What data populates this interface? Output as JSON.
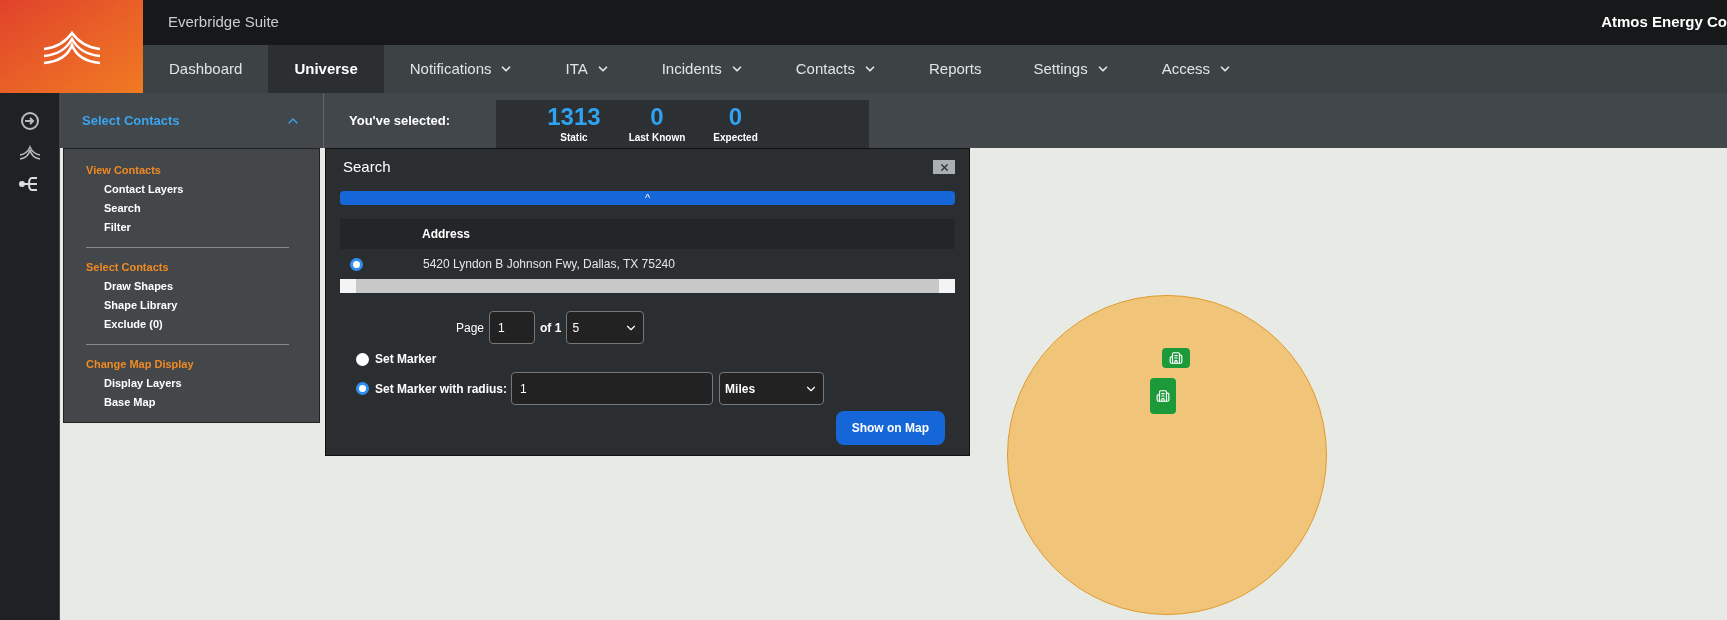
{
  "header": {
    "suite_title": "Everbridge Suite",
    "org_name": "Atmos Energy Co"
  },
  "nav": [
    {
      "label": "Dashboard",
      "selected": false,
      "has_menu": false
    },
    {
      "label": "Universe",
      "selected": true,
      "has_menu": false
    },
    {
      "label": "Notifications",
      "selected": false,
      "has_menu": true
    },
    {
      "label": "ITA",
      "selected": false,
      "has_menu": true
    },
    {
      "label": "Incidents",
      "selected": false,
      "has_menu": true
    },
    {
      "label": "Contacts",
      "selected": false,
      "has_menu": true
    },
    {
      "label": "Reports",
      "selected": false,
      "has_menu": false
    },
    {
      "label": "Settings",
      "selected": false,
      "has_menu": true
    },
    {
      "label": "Access",
      "selected": false,
      "has_menu": true
    }
  ],
  "select_contacts": {
    "label": "Select Contacts",
    "expanded": true
  },
  "selection_summary": {
    "label": "You've selected:",
    "counters": [
      {
        "value": "1313",
        "caption": "Static"
      },
      {
        "value": "0",
        "caption": "Last Known"
      },
      {
        "value": "0",
        "caption": "Expected"
      }
    ]
  },
  "menu": [
    {
      "heading": "View Contacts",
      "items": [
        "Contact Layers",
        "Search",
        "Filter"
      ]
    },
    {
      "heading": "Select Contacts",
      "items": [
        "Draw Shapes",
        "Shape Library",
        "Exclude (0)"
      ]
    },
    {
      "heading": "Change Map Display",
      "items": [
        "Display Layers",
        "Base Map"
      ]
    }
  ],
  "search_dialog": {
    "title": "Search",
    "collapse_glyph": "^",
    "column": "Address",
    "results": [
      {
        "address": "5420 Lyndon B Johnson Fwy, Dallas, TX 75240",
        "selected": true
      }
    ],
    "page_label": "Page",
    "page_value": "1",
    "page_of": "of 1",
    "page_size": "5",
    "marker_options": [
      {
        "label": "Set Marker",
        "selected": false,
        "kind": "plain"
      },
      {
        "label": "Set Marker with radius:",
        "selected": true,
        "kind": "radius"
      }
    ],
    "radius_value": "1",
    "radius_unit": "Miles",
    "submit": "Show on Map"
  }
}
